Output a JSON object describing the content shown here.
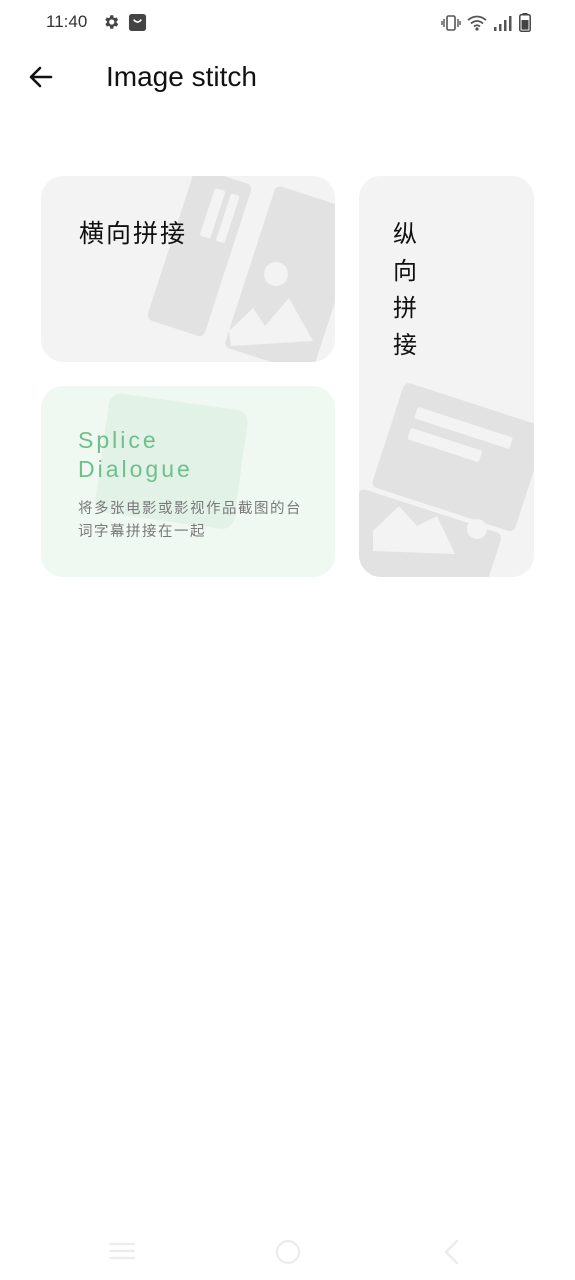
{
  "status_bar": {
    "time": "11:40",
    "icons": [
      "gear-icon",
      "store-bag-icon",
      "vibrate-icon",
      "wifi-icon",
      "signal-icon",
      "battery-icon"
    ]
  },
  "header": {
    "title": "Image stitch",
    "back_icon": "arrow-left-icon"
  },
  "cards": {
    "horizontal": {
      "label": "横向拼接"
    },
    "vertical": {
      "label": "纵向拼接"
    },
    "dialogue": {
      "title": "Splice Dialogue",
      "description": "将多张电影或影视作品截图的台词字幕拼接在一起"
    }
  },
  "nav_bar": {
    "icons": [
      "menu-icon",
      "home-icon",
      "back-icon"
    ]
  },
  "colors": {
    "card_gray": "#f3f3f3",
    "card_green": "#eff8f1",
    "accent_green": "#6fbf8c",
    "watermark": "#e2e2e2"
  }
}
